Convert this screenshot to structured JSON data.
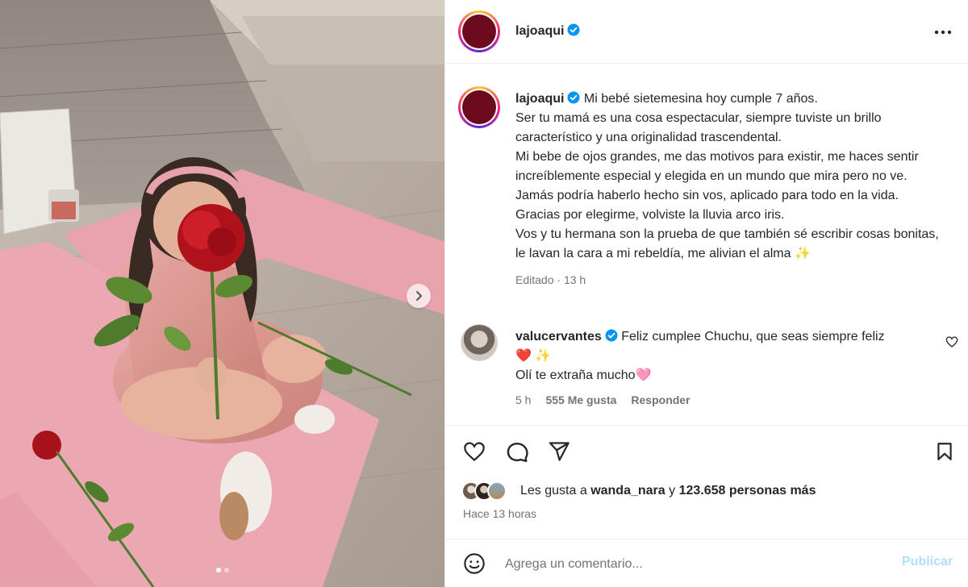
{
  "post": {
    "author": "lajoaqui",
    "caption_author": "lajoaqui",
    "caption_lines": [
      "Mi bebé sietemesina hoy cumple 7 años.",
      "Ser tu mamá es una cosa espectacular, siempre tuviste un brillo característico y una originalidad trascendental.",
      "Mi bebe de ojos grandes, me das motivos para existir, me haces sentir increíblemente especial y elegida en un mundo que mira pero no ve.",
      "Jamás podría haberlo hecho sin vos, aplicado para todo en la vida.",
      "Gracias por elegirme, volviste la lluvia arco iris.",
      "Vos y tu hermana son la prueba de que también sé escribir cosas bonitas, le lavan la cara a mi rebeldía, me alivian el alma ✨"
    ],
    "edited_label": "Editado",
    "edited_time": "13 h",
    "carousel": {
      "slides": 2,
      "active": 0
    }
  },
  "comment": {
    "author": "valucervantes",
    "line1": "Feliz cumplee Chuchu, que seas siempre feliz",
    "line2": "❤️ ✨",
    "line3": "Olí te extraña mucho🩷",
    "time": "5 h",
    "likes": "555 Me gusta",
    "reply": "Responder"
  },
  "likes": {
    "prefix": "Les gusta a",
    "user": "wanda_nara",
    "joiner": "y",
    "count": "123.658 personas más",
    "time_ago": "Hace 13 horas"
  },
  "composer": {
    "placeholder": "Agrega un comentario...",
    "post_label": "Publicar"
  },
  "icons": {
    "more": "more-horizontal-icon",
    "like": "heart-icon",
    "comment": "comment-bubble-icon",
    "share": "paper-plane-icon",
    "save": "bookmark-icon",
    "emoji": "smiley-icon",
    "verified": "verified-badge-icon",
    "next": "chevron-right-icon"
  },
  "colors": {
    "verified": "#0095f6",
    "post_button_disabled": "#b2dffc",
    "avatar": "#6e0a1e",
    "mat_pink": "#e9a3ae"
  }
}
